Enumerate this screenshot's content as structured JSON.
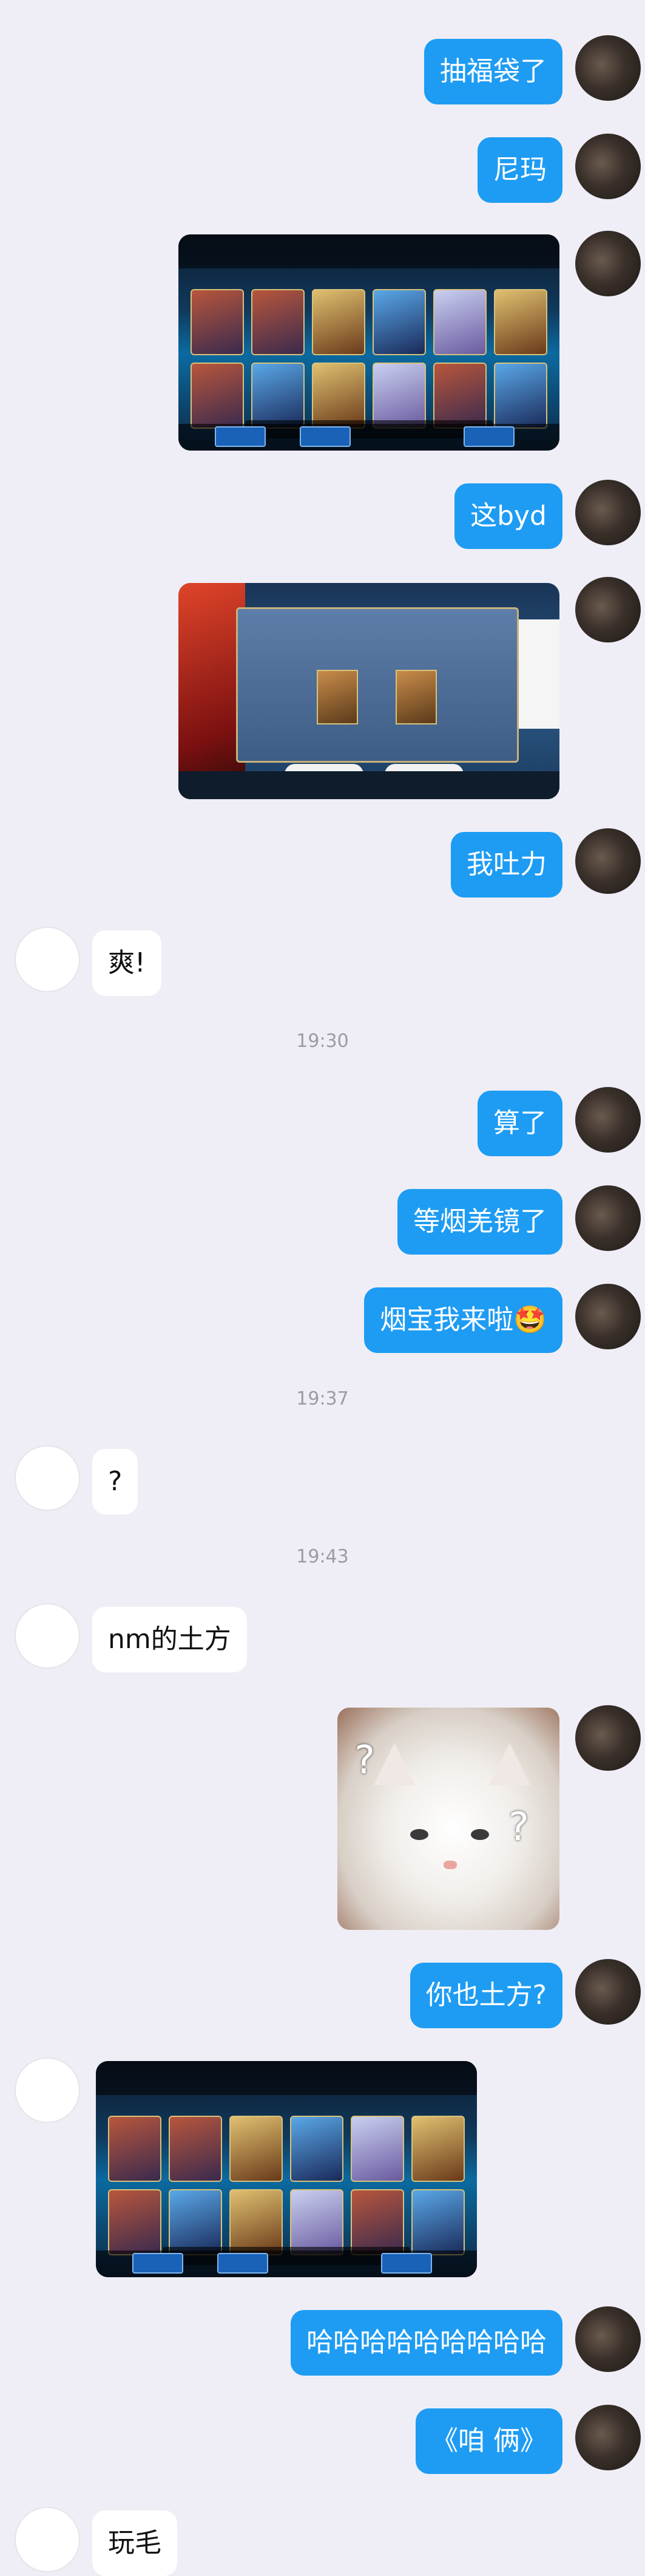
{
  "messages": [
    {
      "from": "me",
      "type": "text",
      "text": "抽福袋了"
    },
    {
      "from": "me",
      "type": "text",
      "text": "尼玛"
    },
    {
      "from": "me",
      "type": "image",
      "image": "game-lucky-bag-result-screenshot"
    },
    {
      "from": "me",
      "type": "text",
      "text": "这byd"
    },
    {
      "from": "me",
      "type": "image",
      "image": "game-strengthen-dialog-screenshot"
    },
    {
      "from": "me",
      "type": "text",
      "text": "我吐力"
    },
    {
      "from": "other",
      "type": "text",
      "text": "爽!"
    },
    {
      "type": "time",
      "text": "19:30"
    },
    {
      "from": "me",
      "type": "text",
      "text": "算了"
    },
    {
      "from": "me",
      "type": "text",
      "text": "等烟羌镜了"
    },
    {
      "from": "me",
      "type": "text",
      "text": "烟宝我来啦🤩"
    },
    {
      "type": "time",
      "text": "19:37"
    },
    {
      "from": "other",
      "type": "text",
      "text": "?"
    },
    {
      "type": "time",
      "text": "19:43"
    },
    {
      "from": "other",
      "type": "text",
      "text": "nm的土方"
    },
    {
      "from": "me",
      "type": "image",
      "image": "confused-white-cat-sticker"
    },
    {
      "from": "me",
      "type": "text",
      "text": "你也土方?"
    },
    {
      "from": "other",
      "type": "image",
      "image": "game-lucky-bag-result-screenshot-2"
    },
    {
      "from": "me",
      "type": "text",
      "text": "哈哈哈哈哈哈哈哈哈"
    },
    {
      "from": "me",
      "type": "text",
      "text": "《咱 俩》"
    },
    {
      "from": "other",
      "type": "text",
      "text": "玩毛"
    }
  ],
  "cat_sticker": {
    "marks": [
      "?",
      "?"
    ]
  },
  "colors": {
    "my_bubble": "#1e9cf3",
    "other_bubble": "#ffffff",
    "background": "#efeef6"
  }
}
